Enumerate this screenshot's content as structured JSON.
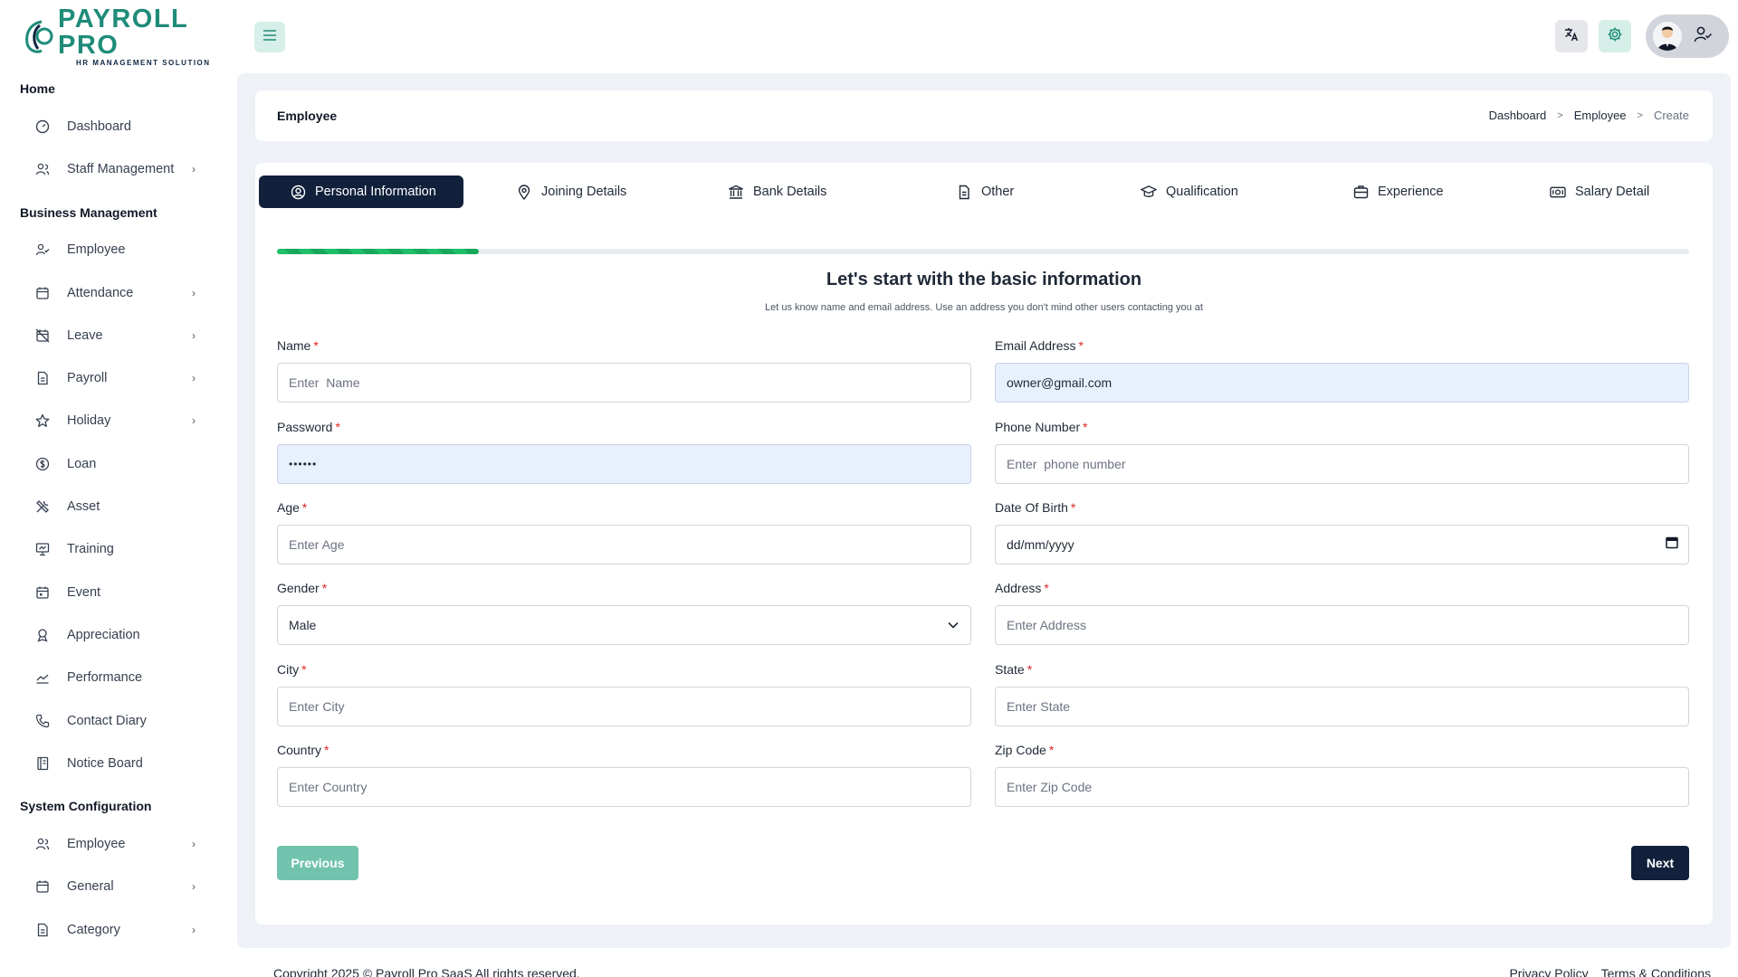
{
  "brand": {
    "title": "PAYROLL PRO",
    "subtitle": "HR MANAGEMENT SOLUTION",
    "primary_color": "#1e8c78",
    "navy_color": "#11203b"
  },
  "sidebar": {
    "sections": [
      {
        "label": "Home",
        "items": [
          {
            "label": "Dashboard",
            "icon": "gauge-icon",
            "has_submenu": false
          },
          {
            "label": "Staff Management",
            "icon": "users-icon",
            "has_submenu": true
          }
        ]
      },
      {
        "label": "Business Management",
        "items": [
          {
            "label": "Employee",
            "icon": "user-check-icon",
            "has_submenu": false
          },
          {
            "label": "Attendance",
            "icon": "calendar-icon",
            "has_submenu": true
          },
          {
            "label": "Leave",
            "icon": "calendar-off-icon",
            "has_submenu": true
          },
          {
            "label": "Payroll",
            "icon": "file-icon",
            "has_submenu": true
          },
          {
            "label": "Holiday",
            "icon": "star-icon",
            "has_submenu": true
          },
          {
            "label": "Loan",
            "icon": "dollar-icon",
            "has_submenu": false
          },
          {
            "label": "Asset",
            "icon": "tools-icon",
            "has_submenu": false
          },
          {
            "label": "Training",
            "icon": "presentation-icon",
            "has_submenu": false
          },
          {
            "label": "Event",
            "icon": "calendar-event-icon",
            "has_submenu": false
          },
          {
            "label": "Appreciation",
            "icon": "award-icon",
            "has_submenu": false
          },
          {
            "label": "Performance",
            "icon": "trend-icon",
            "has_submenu": false
          },
          {
            "label": "Contact Diary",
            "icon": "phone-icon",
            "has_submenu": false
          },
          {
            "label": "Notice Board",
            "icon": "notebook-icon",
            "has_submenu": false
          }
        ]
      },
      {
        "label": "System Configuration",
        "items": [
          {
            "label": "Employee",
            "icon": "users-icon",
            "has_submenu": true
          },
          {
            "label": "General",
            "icon": "calendar-icon",
            "has_submenu": true
          },
          {
            "label": "Category",
            "icon": "file-icon",
            "has_submenu": true
          }
        ]
      }
    ]
  },
  "header": {
    "page_title": "Employee",
    "breadcrumbs": [
      "Dashboard",
      "Employee",
      "Create"
    ]
  },
  "tabs": [
    {
      "label": "Personal Information",
      "icon": "user-circle-icon",
      "active": true
    },
    {
      "label": "Joining Details",
      "icon": "map-pin-icon",
      "active": false
    },
    {
      "label": "Bank Details",
      "icon": "bank-icon",
      "active": false
    },
    {
      "label": "Other",
      "icon": "file-icon",
      "active": false
    },
    {
      "label": "Qualification",
      "icon": "graduation-cap-icon",
      "active": false
    },
    {
      "label": "Experience",
      "icon": "briefcase-icon",
      "active": false
    },
    {
      "label": "Salary Detail",
      "icon": "cash-icon",
      "active": false
    }
  ],
  "progress": {
    "fraction": 0.143
  },
  "form": {
    "title": "Let's start with the basic information",
    "subtitle": "Let us know name and email address. Use an address you don't mind other users contacting you at",
    "name": {
      "label": "Name",
      "placeholder": "Enter  Name",
      "value": ""
    },
    "email": {
      "label": "Email Address",
      "value": "owner@gmail.com"
    },
    "password": {
      "label": "Password",
      "value": "••••••"
    },
    "phone": {
      "label": "Phone Number",
      "placeholder": "Enter  phone number",
      "value": ""
    },
    "age": {
      "label": "Age",
      "placeholder": "Enter Age",
      "value": ""
    },
    "dob": {
      "label": "Date Of Birth",
      "placeholder": "dd/mm/yyyy"
    },
    "gender": {
      "label": "Gender",
      "value": "Male"
    },
    "address": {
      "label": "Address",
      "placeholder": "Enter Address",
      "value": ""
    },
    "city": {
      "label": "City",
      "placeholder": "Enter City",
      "value": ""
    },
    "state": {
      "label": "State",
      "placeholder": "Enter State",
      "value": ""
    },
    "country": {
      "label": "Country",
      "placeholder": "Enter Country",
      "value": ""
    },
    "zip": {
      "label": "Zip Code",
      "placeholder": "Enter Zip Code",
      "value": ""
    },
    "required_marker": "*",
    "previous_label": "Previous",
    "next_label": "Next"
  },
  "footer": {
    "copyright": "Copyright 2025 © Payroll Pro SaaS All rights reserved.",
    "links": [
      "Privacy Policy",
      "Terms & Conditions"
    ]
  }
}
